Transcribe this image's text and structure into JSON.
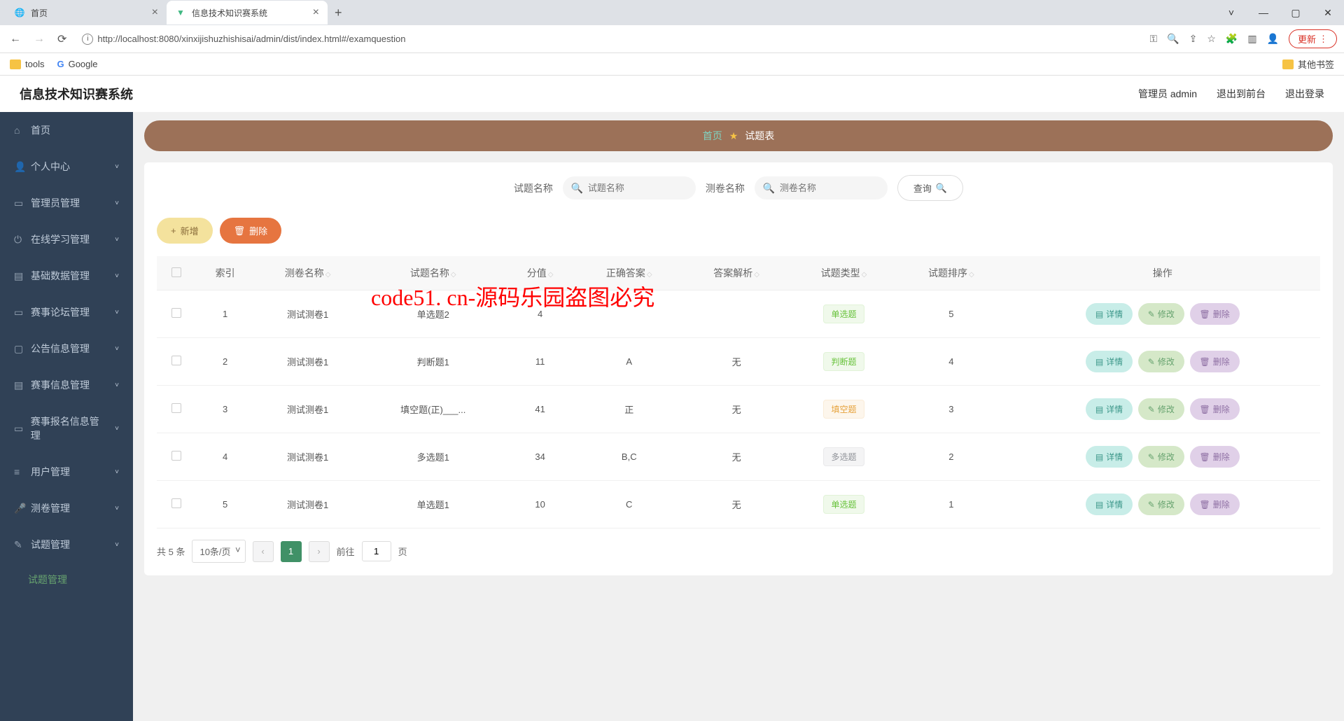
{
  "browser": {
    "tabs": [
      {
        "title": "首页",
        "active": false
      },
      {
        "title": "信息技术知识赛系统",
        "active": true
      }
    ],
    "url": "http://localhost:8080/xinxijishuzhishisai/admin/dist/index.html#/examquestion",
    "update_label": "更新",
    "bookmarks": {
      "tools": "tools",
      "google": "Google",
      "other": "其他书签"
    }
  },
  "header": {
    "title": "信息技术知识赛系统",
    "user": "管理员 admin",
    "exit_front": "退出到前台",
    "logout": "退出登录"
  },
  "sidebar": {
    "items": [
      "首页",
      "个人中心",
      "管理员管理",
      "在线学习管理",
      "基础数据管理",
      "赛事论坛管理",
      "公告信息管理",
      "赛事信息管理",
      "赛事报名信息管理",
      "用户管理",
      "测卷管理",
      "试题管理"
    ],
    "active_sub": "试题管理"
  },
  "breadcrumb": {
    "home": "首页",
    "current": "试题表"
  },
  "search": {
    "label1": "试题名称",
    "ph1": "试题名称",
    "label2": "测卷名称",
    "ph2": "测卷名称",
    "query": "查询"
  },
  "actions": {
    "add": "新增",
    "delete": "删除"
  },
  "table": {
    "headers": [
      "索引",
      "测卷名称",
      "试题名称",
      "分值",
      "正确答案",
      "答案解析",
      "试题类型",
      "试题排序",
      "操作"
    ],
    "ops": {
      "detail": "详情",
      "edit": "修改",
      "delete": "删除"
    },
    "rows": [
      {
        "idx": 1,
        "paper": "测试测卷1",
        "name": "单选题2",
        "score": "4",
        "answer": " ",
        "analysis": " ",
        "type": "单选题",
        "type_class": "green",
        "order": 5
      },
      {
        "idx": 2,
        "paper": "测试测卷1",
        "name": "判断题1",
        "score": "11",
        "answer": "A",
        "analysis": "无",
        "type": "判断题",
        "type_class": "green",
        "order": 4
      },
      {
        "idx": 3,
        "paper": "测试测卷1",
        "name": "填空题(正)___...",
        "score": "41",
        "answer": "正",
        "analysis": "无",
        "type": "填空题",
        "type_class": "orange",
        "order": 3
      },
      {
        "idx": 4,
        "paper": "测试测卷1",
        "name": "多选题1",
        "score": "34",
        "answer": "B,C",
        "analysis": "无",
        "type": "多选题",
        "type_class": "gray",
        "order": 2
      },
      {
        "idx": 5,
        "paper": "测试测卷1",
        "name": "单选题1",
        "score": "10",
        "answer": "C",
        "analysis": "无",
        "type": "单选题",
        "type_class": "green",
        "order": 1
      }
    ]
  },
  "pagination": {
    "total": "共 5 条",
    "size": "10条/页",
    "current": "1",
    "goto": "前往",
    "page_suffix": "页",
    "goto_val": "1"
  }
}
